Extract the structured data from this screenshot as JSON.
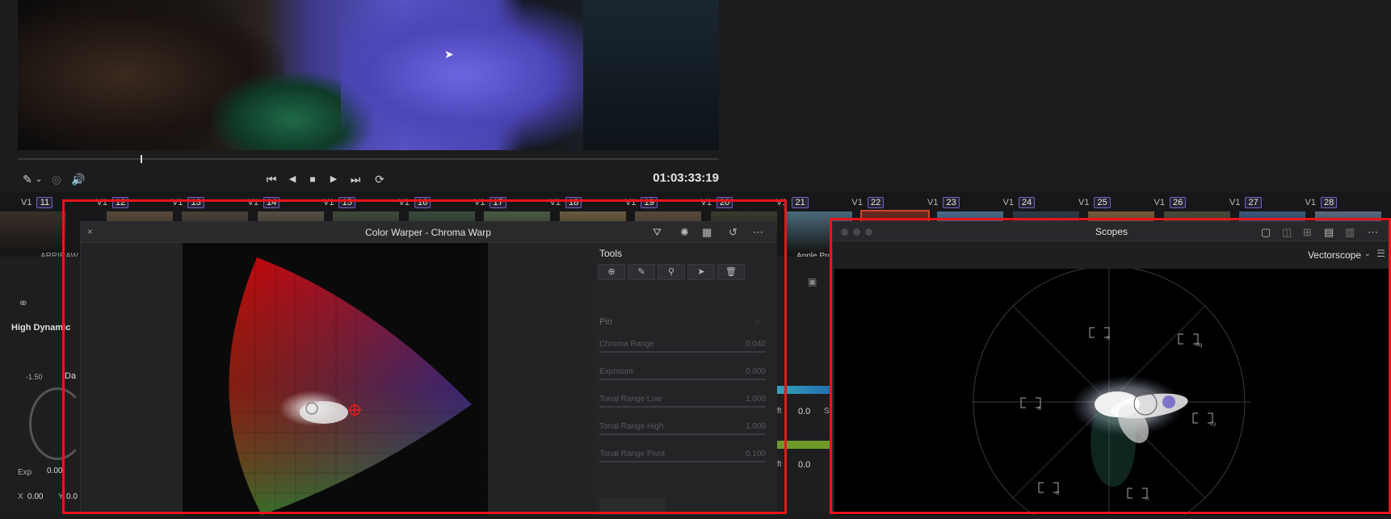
{
  "viewer": {
    "timecode": "01:03:33:19",
    "transport": {
      "pick_icon": "eyedropper-icon",
      "pick_caret": "⌄",
      "skip_back": "⏮",
      "step_back": "◀",
      "stop": "■",
      "play": "▶",
      "skip_forward": "⏭",
      "loop": "⟳",
      "volume": "🔊"
    }
  },
  "timeline": {
    "track": "V1",
    "clips": [
      {
        "num": "11"
      },
      {
        "num": "12"
      },
      {
        "num": "13"
      },
      {
        "num": "14"
      },
      {
        "num": "15"
      },
      {
        "num": "16"
      },
      {
        "num": "17"
      },
      {
        "num": "18"
      },
      {
        "num": "19"
      },
      {
        "num": "20"
      },
      {
        "num": "21"
      },
      {
        "num": "22"
      },
      {
        "num": "23"
      },
      {
        "num": "24"
      },
      {
        "num": "25"
      },
      {
        "num": "26"
      },
      {
        "num": "27"
      },
      {
        "num": "28"
      }
    ],
    "clip_captions": {
      "left": "ARRIRAW",
      "apple": "Apple ProRe"
    }
  },
  "left_panel": {
    "hdr_label": "High Dynamic",
    "value_top": "-1.50",
    "dark_label": "Da",
    "exp_label": "Exp",
    "exp_value": "0.00",
    "x_label": "X",
    "x_value": "0.00",
    "y_label": "Y",
    "y_value": "0.0"
  },
  "mid_panel": {
    "row1_label": "ft",
    "row1_value": "0.0",
    "row2_label": "ft",
    "row2_value": "0.0",
    "s_label": "S"
  },
  "color_warper": {
    "title": "Color Warper - Chroma Warp",
    "close": "×",
    "tools_label": "Tools",
    "pin_label": "Pin",
    "params": [
      {
        "label": "Chroma Range",
        "value": "0.040"
      },
      {
        "label": "Exposure",
        "value": "0.000"
      },
      {
        "label": "Tonal Range Low",
        "value": "1.000"
      },
      {
        "label": "Tonal Range High",
        "value": "1.000"
      },
      {
        "label": "Tonal Range Pivot",
        "value": "0.100"
      }
    ]
  },
  "scopes": {
    "title": "Scopes",
    "mode": "Vectorscope",
    "targets": [
      "R",
      "Mg",
      "B",
      "Cy",
      "G",
      "Yl"
    ]
  },
  "colors": {
    "highlight_box": "#e8151a",
    "clip_badge_border": "#7a5cc8",
    "selected_clip": "#c8472a"
  }
}
